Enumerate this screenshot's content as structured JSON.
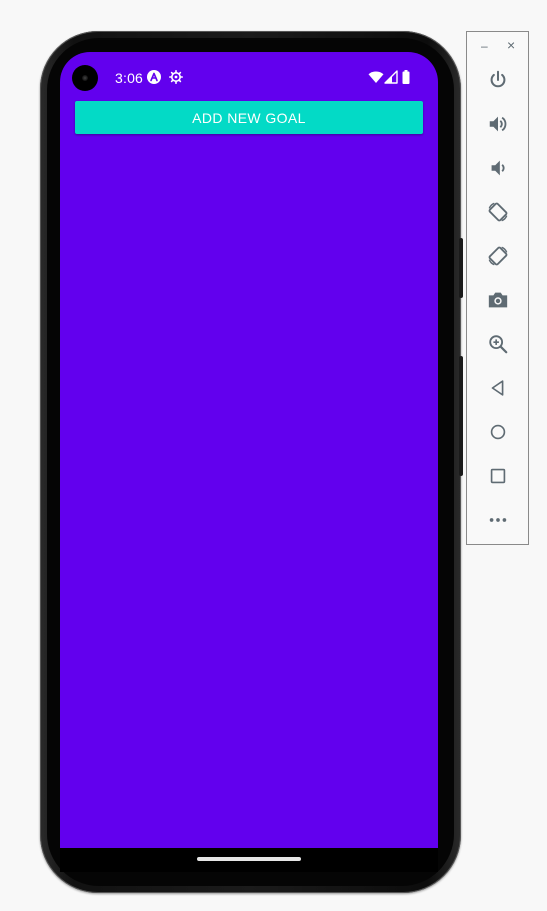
{
  "status_bar": {
    "time": "3:06"
  },
  "app": {
    "add_goal_label": "ADD NEW GOAL"
  },
  "colors": {
    "screen_bg": "#6200ee",
    "accent": "#03dac6",
    "panel_icon": "#5f6b73"
  },
  "emulator": {
    "minimize_label": "–",
    "close_label": "×",
    "buttons": [
      {
        "name": "power",
        "icon": "power-icon"
      },
      {
        "name": "volume-up",
        "icon": "volume-up-icon"
      },
      {
        "name": "volume-down",
        "icon": "volume-down-icon"
      },
      {
        "name": "rotate-left",
        "icon": "rotate-left-icon"
      },
      {
        "name": "rotate-right",
        "icon": "rotate-right-icon"
      },
      {
        "name": "screenshot",
        "icon": "camera-icon"
      },
      {
        "name": "zoom",
        "icon": "zoom-in-icon"
      },
      {
        "name": "back",
        "icon": "back-icon"
      },
      {
        "name": "home",
        "icon": "home-icon"
      },
      {
        "name": "overview",
        "icon": "overview-icon"
      },
      {
        "name": "more",
        "icon": "more-icon"
      }
    ]
  }
}
